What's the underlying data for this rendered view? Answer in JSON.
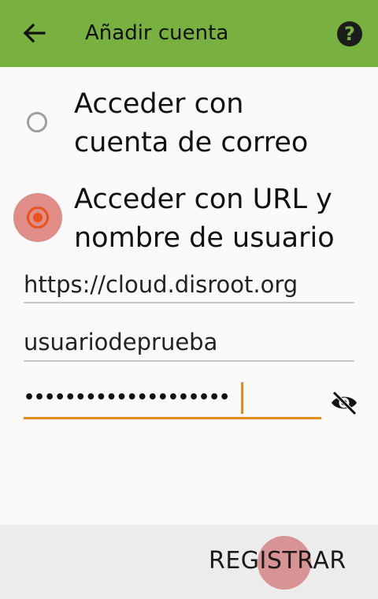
{
  "appbar": {
    "title": "Añadir cuenta",
    "back_icon": "arrow-left-icon",
    "help_icon": "help-circle-icon",
    "help_glyph": "?",
    "background": "#79b140"
  },
  "options": [
    {
      "label_line1": "Acceder con",
      "label_line2": "cuenta de correo",
      "selected": false
    },
    {
      "label_line1": "Acceder con URL y",
      "label_line2": "nombre de usuario",
      "selected": true
    }
  ],
  "form": {
    "server_url": "https://cloud.disroot.org",
    "username": "usuariodeprueba",
    "password_masked": "••••••••••••••••••••",
    "visibility_icon": "eye-off-icon"
  },
  "footer": {
    "register_label": "REGISTRAR"
  },
  "colors": {
    "accent": "#e5531e",
    "focus": "#e58a1f"
  }
}
